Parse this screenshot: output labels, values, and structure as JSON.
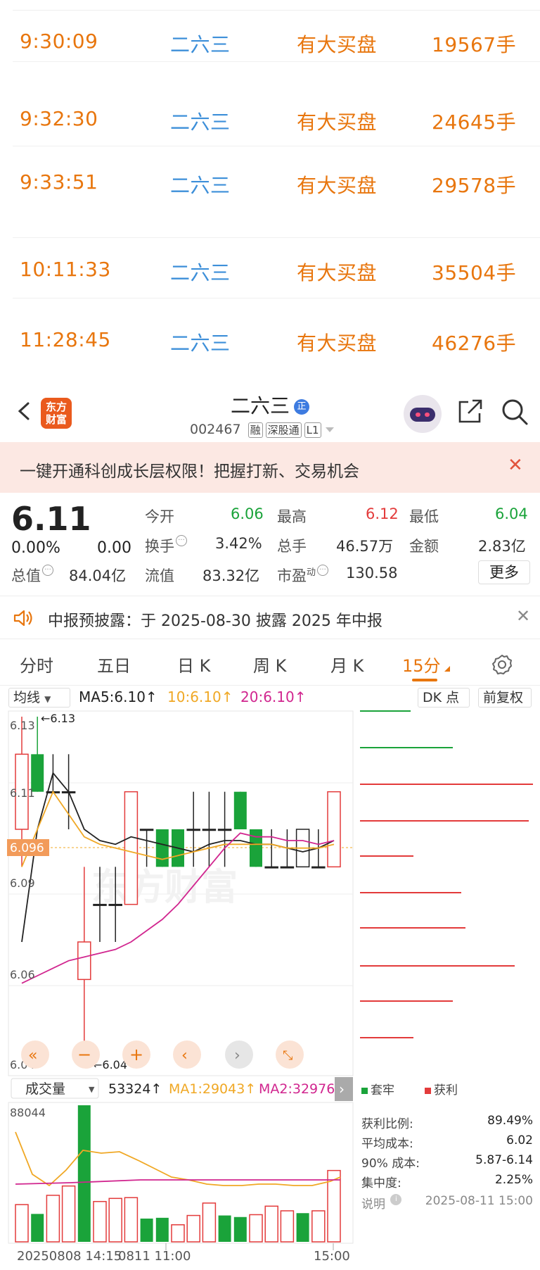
{
  "trades": [
    {
      "time": "9:30:09",
      "name": "二六三",
      "type": "有大买盘",
      "volume": "19567手"
    },
    {
      "time": "9:32:30",
      "name": "二六三",
      "type": "有大买盘",
      "volume": "24645手"
    },
    {
      "time": "9:33:51",
      "name": "二六三",
      "type": "有大买盘",
      "volume": "29578手"
    },
    {
      "time": "10:11:33",
      "name": "二六三",
      "type": "有大买盘",
      "volume": "35504手"
    },
    {
      "time": "11:28:45",
      "name": "二六三",
      "type": "有大买盘",
      "volume": "46276手"
    }
  ],
  "header": {
    "logo_line1": "东方",
    "logo_line2": "财富",
    "stock_name": "二六三",
    "badge": "正",
    "code": "002467",
    "tags": [
      "融",
      "深股通",
      "L1"
    ]
  },
  "banner": {
    "text": "一键开通科创成长层权限！把握打新、交易机会",
    "close": "✕"
  },
  "quote": {
    "price": "6.11",
    "change_pct": "0.00%",
    "change": "0.00",
    "open_label": "今开",
    "open": "6.06",
    "high_label": "最高",
    "high": "6.12",
    "low_label": "最低",
    "low": "6.04",
    "turnover_label": "换手",
    "turnover": "3.42%",
    "vol_label": "总手",
    "vol": "46.57万",
    "amount_label": "金额",
    "amount": "2.83亿",
    "mktcap_label": "总值",
    "mktcap": "84.04亿",
    "float_label": "流值",
    "float": "83.32亿",
    "pe_label": "市盈",
    "pe_sup": "动",
    "pe": "130.58",
    "more": "更多"
  },
  "notice": {
    "text": "中报预披露：于 2025-08-30 披露 2025 年中报",
    "close": "✕"
  },
  "tabs": [
    "分时",
    "五日",
    "日 K",
    "周 K",
    "月 K",
    "15分"
  ],
  "active_tab": "15分",
  "chart_toolbar": {
    "indicator": "均线",
    "ma5": "MA5:6.10↑",
    "ma10": "10:6.10↑",
    "ma20": "20:6.10↑",
    "dk": "DK 点",
    "adjust": "前复权"
  },
  "chart_labels": {
    "y_top": "6.13",
    "arrow_high": "←6.13",
    "y_611": "6.11",
    "y_current": "6.096",
    "y_609": "6.09",
    "y_606": "6.06",
    "y_604": "6.04",
    "arrow_low": "←6.04",
    "watermark": "东方财富"
  },
  "volume_toolbar": {
    "indicator": "成交量",
    "vol": "53324↑",
    "ma1": "MA1:29043↑",
    "ma2": "MA2:32976↑",
    "max": "88044"
  },
  "x_labels": {
    "left": "20250808 14:15",
    "mid": "0811 11:00",
    "right": "15:00"
  },
  "holdings": {
    "legend_trapped": "套牢",
    "legend_profit": "获利",
    "profit_ratio_label": "获利比例:",
    "profit_ratio": "89.49%",
    "avg_cost_label": "平均成本:",
    "avg_cost": "6.02",
    "cost90_label": "90% 成本:",
    "cost90": "5.87-6.14",
    "concentration_label": "集中度:",
    "concentration": "2.25%",
    "note_label": "说明",
    "note_time": "2025-08-11 15:00"
  },
  "colors": {
    "up": "#e33b3b",
    "down": "#1aa33a",
    "accent": "#e8760e",
    "link": "#3d8fd9"
  },
  "chart_data": {
    "type": "candlestick",
    "ylim": [
      6.04,
      6.13
    ],
    "candles": [
      {
        "o": 6.1,
        "c": 6.12,
        "h": 6.13,
        "l": 6.09,
        "dir": "up"
      },
      {
        "o": 6.12,
        "c": 6.11,
        "h": 6.13,
        "l": 6.11,
        "dir": "down"
      },
      {
        "o": 6.11,
        "c": 6.11,
        "h": 6.12,
        "l": 6.11,
        "dir": "flat"
      },
      {
        "o": 6.11,
        "c": 6.11,
        "h": 6.12,
        "l": 6.1,
        "dir": "flat"
      },
      {
        "o": 6.06,
        "c": 6.07,
        "h": 6.09,
        "l": 6.04,
        "dir": "up"
      },
      {
        "o": 6.08,
        "c": 6.08,
        "h": 6.09,
        "l": 6.07,
        "dir": "flat"
      },
      {
        "o": 6.08,
        "c": 6.08,
        "h": 6.09,
        "l": 6.07,
        "dir": "flat"
      },
      {
        "o": 6.08,
        "c": 6.11,
        "h": 6.11,
        "l": 6.08,
        "dir": "up"
      },
      {
        "o": 6.1,
        "c": 6.1,
        "h": 6.1,
        "l": 6.09,
        "dir": "flat"
      },
      {
        "o": 6.1,
        "c": 6.09,
        "h": 6.1,
        "l": 6.09,
        "dir": "down"
      },
      {
        "o": 6.1,
        "c": 6.09,
        "h": 6.1,
        "l": 6.09,
        "dir": "down"
      },
      {
        "o": 6.1,
        "c": 6.1,
        "h": 6.11,
        "l": 6.09,
        "dir": "flat"
      },
      {
        "o": 6.1,
        "c": 6.1,
        "h": 6.11,
        "l": 6.09,
        "dir": "flat"
      },
      {
        "o": 6.1,
        "c": 6.1,
        "h": 6.11,
        "l": 6.09,
        "dir": "flat"
      },
      {
        "o": 6.11,
        "c": 6.1,
        "h": 6.11,
        "l": 6.1,
        "dir": "down"
      },
      {
        "o": 6.1,
        "c": 6.09,
        "h": 6.1,
        "l": 6.09,
        "dir": "down"
      },
      {
        "o": 6.09,
        "c": 6.09,
        "h": 6.1,
        "l": 6.09,
        "dir": "flat"
      },
      {
        "o": 6.09,
        "c": 6.09,
        "h": 6.1,
        "l": 6.09,
        "dir": "flat"
      },
      {
        "o": 6.1,
        "c": 6.09,
        "h": 6.1,
        "l": 6.09,
        "dir": "flat"
      },
      {
        "o": 6.09,
        "c": 6.09,
        "h": 6.1,
        "l": 6.09,
        "dir": "flat"
      },
      {
        "o": 6.09,
        "c": 6.11,
        "h": 6.11,
        "l": 6.09,
        "dir": "up"
      }
    ],
    "volumes": [
      {
        "v": 24000,
        "dir": "up"
      },
      {
        "v": 18000,
        "dir": "down"
      },
      {
        "v": 30000,
        "dir": "up"
      },
      {
        "v": 36000,
        "dir": "up"
      },
      {
        "v": 88044,
        "dir": "down"
      },
      {
        "v": 26000,
        "dir": "up"
      },
      {
        "v": 28000,
        "dir": "up"
      },
      {
        "v": 28500,
        "dir": "up"
      },
      {
        "v": 15000,
        "dir": "down"
      },
      {
        "v": 15500,
        "dir": "down"
      },
      {
        "v": 11000,
        "dir": "up"
      },
      {
        "v": 17000,
        "dir": "up"
      },
      {
        "v": 25000,
        "dir": "up"
      },
      {
        "v": 17000,
        "dir": "down"
      },
      {
        "v": 16000,
        "dir": "down"
      },
      {
        "v": 17500,
        "dir": "up"
      },
      {
        "v": 23000,
        "dir": "up"
      },
      {
        "v": 20000,
        "dir": "up"
      },
      {
        "v": 18500,
        "dir": "down"
      },
      {
        "v": 20000,
        "dir": "up"
      },
      {
        "v": 46000,
        "dir": "up"
      }
    ],
    "ma5": [
      6.07,
      6.1,
      6.115,
      6.11,
      6.1,
      6.097,
      6.096,
      6.098,
      6.097,
      6.096,
      6.095,
      6.094,
      6.096,
      6.097,
      6.097,
      6.096,
      6.096,
      6.095,
      6.094,
      6.095,
      6.097
    ],
    "ma10": [
      6.09,
      6.1,
      6.11,
      6.104,
      6.098,
      6.096,
      6.095,
      6.094,
      6.093,
      6.092,
      6.093,
      6.094,
      6.095,
      6.096,
      6.096,
      6.096,
      6.096,
      6.095,
      6.095,
      6.095,
      6.096
    ],
    "ma20": [
      6.059,
      6.061,
      6.063,
      6.065,
      6.066,
      6.067,
      6.068,
      6.07,
      6.073,
      6.076,
      6.08,
      6.085,
      6.09,
      6.095,
      6.099,
      6.098,
      6.098,
      6.097,
      6.097,
      6.096,
      6.097
    ]
  }
}
